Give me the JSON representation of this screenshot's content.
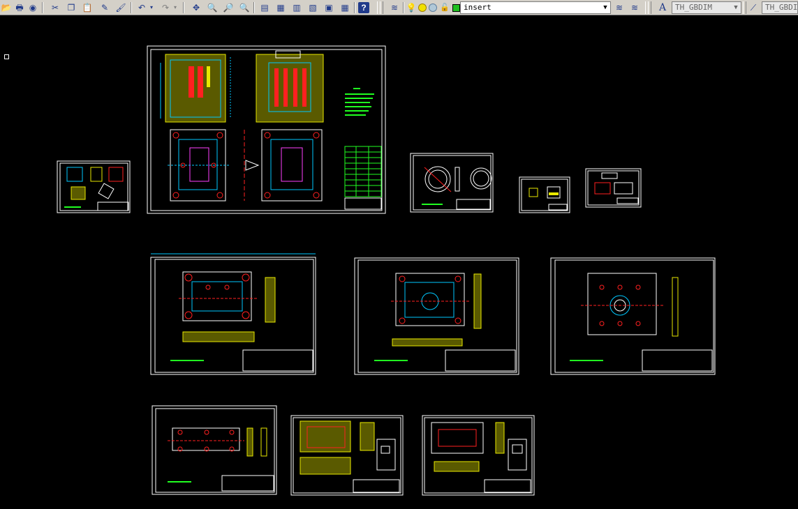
{
  "toolbar": {
    "layer_combo": {
      "value": "insert"
    },
    "dimstyle_combo": {
      "value": "TH_GBDIM"
    },
    "dimstyle_combo2": {
      "value": "TH_GBDIM"
    },
    "icons": [
      "open-icon",
      "plot-icon",
      "preview-icon",
      "cut-icon",
      "copy-icon",
      "paste-icon",
      "match-properties-icon",
      "brush-icon",
      "undo-icon",
      "redo-icon",
      "pan-icon",
      "zoom-realtime-icon",
      "zoom-window-icon",
      "zoom-previous-icon",
      "properties-icon",
      "design-center-icon",
      "tool-palettes-icon",
      "sheet-set-icon",
      "markup-icon",
      "calculator-icon",
      "help-icon",
      "layer-manager-icon",
      "bulb-icon",
      "sun-icon",
      "freeze-icon",
      "lock-icon",
      "color-swatch-icon",
      "make-current-icon",
      "layer-previous-icon",
      "text-style-icon",
      "dim-style-icon"
    ]
  },
  "colors": {
    "background": "#000000",
    "frame": "#ffffff",
    "cyan": "#00c8ff",
    "yellow": "#e8e800",
    "red": "#ff2020",
    "green": "#20ff20",
    "magenta": "#ff40ff"
  }
}
